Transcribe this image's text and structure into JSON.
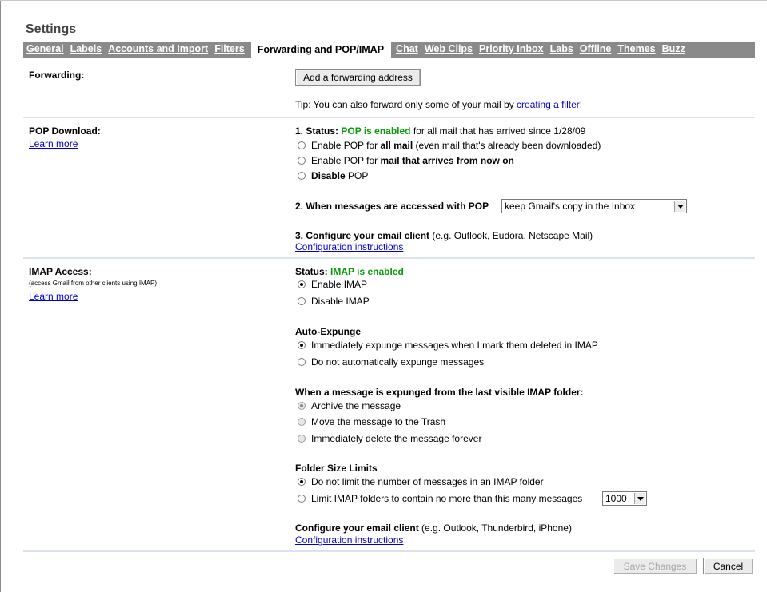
{
  "header": {
    "title": "Settings"
  },
  "tabs": [
    {
      "label": "General",
      "active": false
    },
    {
      "label": "Labels",
      "active": false
    },
    {
      "label": "Accounts and Import",
      "active": false
    },
    {
      "label": "Filters",
      "active": false
    },
    {
      "label": "Forwarding and POP/IMAP",
      "active": true
    },
    {
      "label": "Chat",
      "active": false
    },
    {
      "label": "Web Clips",
      "active": false
    },
    {
      "label": "Priority Inbox",
      "active": false
    },
    {
      "label": "Labs",
      "active": false
    },
    {
      "label": "Offline",
      "active": false
    },
    {
      "label": "Themes",
      "active": false
    },
    {
      "label": "Buzz",
      "active": false
    }
  ],
  "forwarding": {
    "label": "Forwarding:",
    "add_button": "Add a forwarding address",
    "tip_prefix": "Tip: You can also forward only some of your mail by",
    "tip_link": "creating a filter!"
  },
  "pop": {
    "label": "POP Download:",
    "learn_more": "Learn more",
    "status_prefix": "1. Status:",
    "status_value": "POP is enabled",
    "status_suffix": "for all mail that has arrived since 1/28/09",
    "options": [
      {
        "pre": "Enable POP for",
        "bold": "all mail",
        "post": "(even mail that's already been downloaded)",
        "checked": false
      },
      {
        "pre": "Enable POP for",
        "bold": "mail that arrives from now on",
        "post": "",
        "checked": false
      },
      {
        "pre": "",
        "bold": "Disable",
        "post": "POP",
        "checked": false
      }
    ],
    "access_label": "2. When messages are accessed with POP",
    "access_value": "keep Gmail's copy in the Inbox",
    "config_label": "3. Configure your email client",
    "config_suffix": "(e.g. Outlook, Eudora, Netscape Mail)",
    "config_link": "Configuration instructions"
  },
  "imap": {
    "label": "IMAP Access:",
    "note": "(access Gmail from other clients using IMAP)",
    "learn_more": "Learn more",
    "status_prefix": "Status:",
    "status_value": "IMAP is enabled",
    "enable_options": [
      {
        "label": "Enable IMAP",
        "checked": true
      },
      {
        "label": "Disable IMAP",
        "checked": false
      }
    ],
    "expunge_title": "Auto-Expunge",
    "expunge_options": [
      {
        "label": "Immediately expunge messages when I mark them deleted in IMAP",
        "checked": true
      },
      {
        "label": "Do not automatically expunge messages",
        "checked": false
      }
    ],
    "folder_title": "When a message is expunged from the last visible IMAP folder:",
    "folder_options": [
      {
        "label": "Archive the message",
        "checked": true
      },
      {
        "label": "Move the message to the Trash",
        "checked": false
      },
      {
        "label": "Immediately delete the message forever",
        "checked": false
      }
    ],
    "size_title": "Folder Size Limits",
    "size_options": [
      {
        "label": "Do not limit the number of messages in an IMAP folder",
        "checked": true
      },
      {
        "label": "Limit IMAP folders to contain no more than this many messages",
        "checked": false
      }
    ],
    "size_value": "1000",
    "config_label": "Configure your email client",
    "config_suffix": "(e.g. Outlook, Thunderbird, iPhone)",
    "config_link": "Configuration instructions"
  },
  "footer": {
    "save_label": "Save Changes",
    "cancel_label": "Cancel"
  }
}
